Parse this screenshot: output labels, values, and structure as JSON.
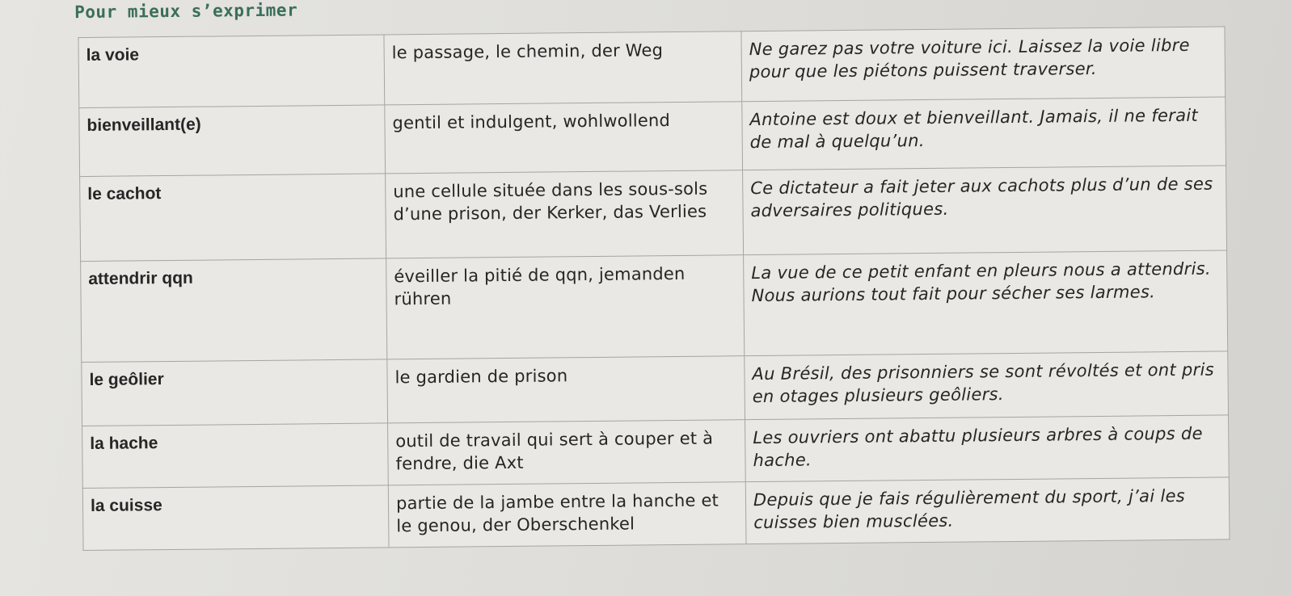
{
  "heading": "Pour mieux s’exprimer",
  "rows": [
    {
      "term": "la voie",
      "definition": "le passage, le chemin, der Weg",
      "example": "Ne garez pas votre voiture ici. Laissez la voie libre pour que les piétons puissent traverser."
    },
    {
      "term": "bienveillant(e)",
      "definition": "gentil et indulgent, wohlwollend",
      "example": "Antoine est doux et bienveillant. Jamais, il ne ferait de mal à quelqu’un."
    },
    {
      "term": "le cachot",
      "definition": "une cellule située dans les sous-sols d’une prison, der Kerker, das Verlies",
      "example": "Ce dictateur a fait jeter aux cachots plus d’un de ses adversaires politiques."
    },
    {
      "term": "attendrir qqn",
      "definition": "éveiller la pitié de qqn, jemanden rühren",
      "example": "La vue de ce petit enfant en pleurs nous a attendris. Nous aurions tout fait pour sécher ses larmes."
    },
    {
      "term": "le geôlier",
      "definition": "le gardien de prison",
      "example": "Au Brésil, des prisonniers se sont révoltés et ont pris en otages plusieurs geôliers."
    },
    {
      "term": "la hache",
      "definition": "outil de travail qui sert à couper et à fendre, die Axt",
      "example": "Les ouvriers ont abattu plusieurs arbres à coups de hache."
    },
    {
      "term": "la cuisse",
      "definition": "partie de la jambe entre la hanche et le genou, der Oberschenkel",
      "example": "Depuis que je fais régulièrement du sport, j’ai les cuisses bien musclées."
    }
  ]
}
